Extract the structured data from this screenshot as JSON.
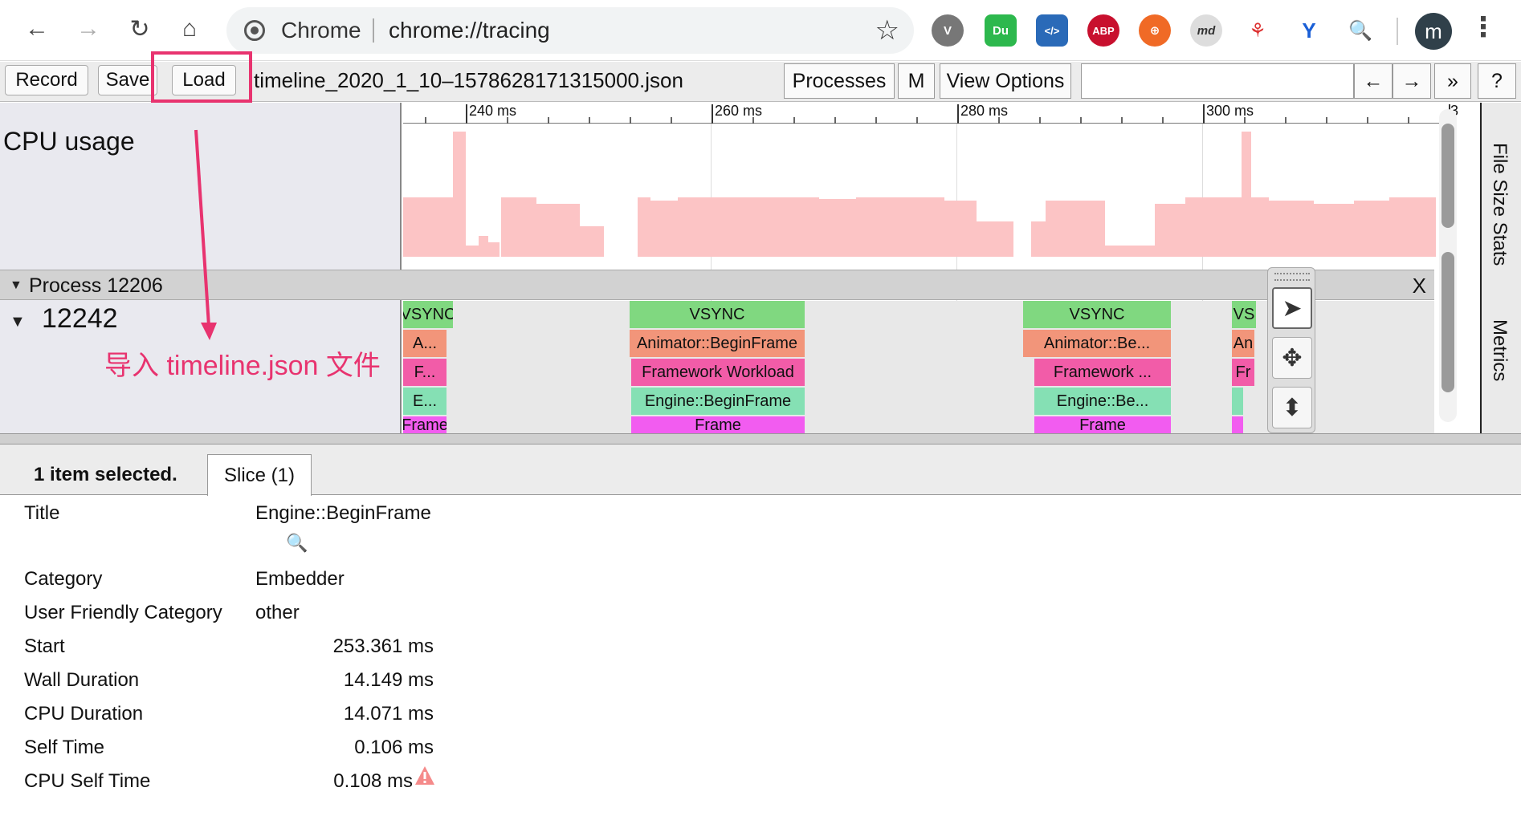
{
  "browser": {
    "site_name": "Chrome",
    "url": "chrome://tracing",
    "avatar_letter": "m",
    "extensions": [
      "V",
      "Du",
      "</>",
      "ABP",
      "⊕",
      "md",
      "⚘",
      "Y",
      "🔍"
    ]
  },
  "toolbar": {
    "record": "Record",
    "save": "Save",
    "load": "Load",
    "filename": "timeline_2020_1_10–1578628171315000.json",
    "processes": "Processes",
    "m": "M",
    "view_options": "View Options",
    "nav_left": "←",
    "nav_right": "→",
    "more": "»",
    "help": "?"
  },
  "timeline": {
    "cpu_label": "CPU usage",
    "ruler_ticks": [
      "240 ms",
      "260 ms",
      "280 ms",
      "300 ms",
      "3"
    ],
    "process_label": "Process 12206",
    "process_close": "X",
    "thread_label": "12242",
    "slices": {
      "g1": [
        "VSYNC",
        "A...",
        "F...",
        "E...",
        "Frame"
      ],
      "g2": [
        "VSYNC",
        "Animator::BeginFrame",
        "Framework Workload",
        "Engine::BeginFrame",
        "Frame"
      ],
      "g3": [
        "VSYNC",
        "Animator::Be...",
        "Framework ...",
        "Engine::Be...",
        "Frame"
      ],
      "g4": [
        "VS",
        "An",
        "Fr"
      ]
    },
    "side_tabs": [
      "File Size Stats",
      "Metrics"
    ],
    "annotation": "导入 timeline.json 文件"
  },
  "analysis": {
    "selected_count": "1 item selected.",
    "tab": "Slice (1)",
    "props": {
      "title_name": "Title",
      "title_val": "Engine::BeginFrame",
      "category_name": "Category",
      "category_val": "Embedder",
      "ufc_name": "User Friendly Category",
      "ufc_val": "other",
      "start_name": "Start",
      "start_val": "253.361 ms",
      "wall_name": "Wall Duration",
      "wall_val": "14.149 ms",
      "cpu_name": "CPU Duration",
      "cpu_val": "14.071 ms",
      "self_name": "Self Time",
      "self_val": "0.106 ms",
      "cpuself_name": "CPU Self Time",
      "cpuself_val": "0.108 ms"
    }
  },
  "colors": {
    "highlight": "#e8336f",
    "cpu_fill": "#fcc4c5",
    "vsync": "#80d880",
    "animator": "#f2957a",
    "framework": "#f25ca8",
    "engine": "#85e0b4",
    "frame": "#f25cf0"
  }
}
